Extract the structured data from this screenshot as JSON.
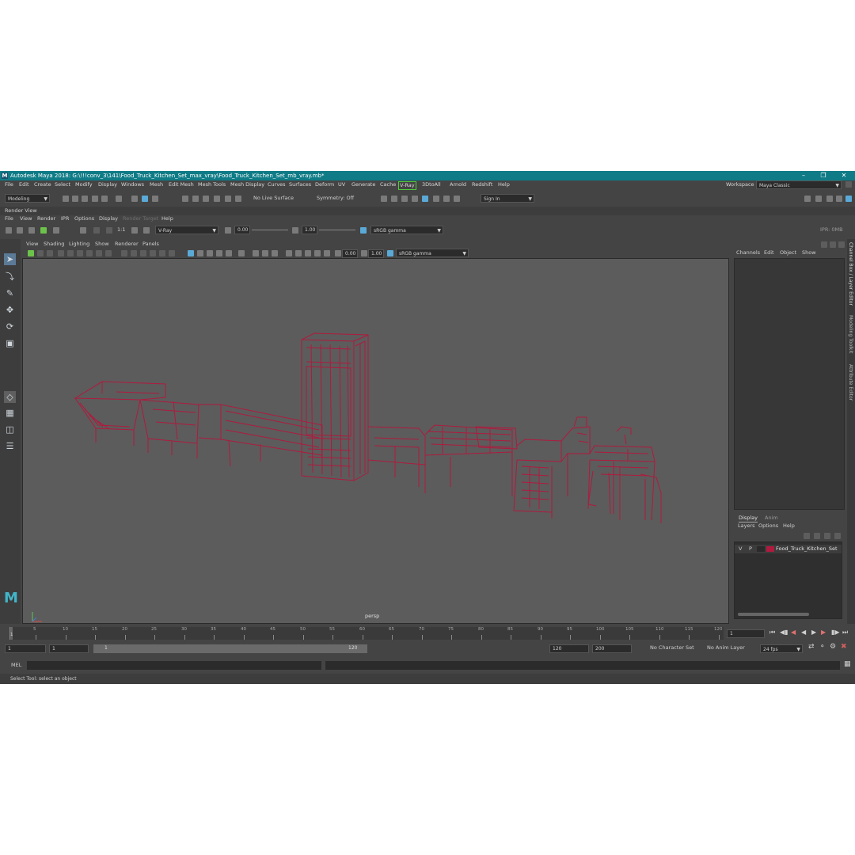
{
  "title": "Autodesk Maya 2018: G:\\!!!conv_3\\141\\Food_Truck_Kitchen_Set_max_vray\\Food_Truck_Kitchen_Set_mb_vray.mb*",
  "menubar": [
    "File",
    "Edit",
    "Create",
    "Select",
    "Modify",
    "Display",
    "Windows",
    "Mesh",
    "Edit Mesh",
    "Mesh Tools",
    "Mesh Display",
    "Curves",
    "Surfaces",
    "Deform",
    "UV",
    "Generate",
    "Cache",
    "V-Ray",
    "3DtoAll",
    "Arnold",
    "Redshift",
    "Help"
  ],
  "workspace_label": "Workspace :",
  "workspace_value": "Maya Classic",
  "shelf": {
    "mode": "Modeling",
    "live_surface": "No Live Surface",
    "symmetry": "Symmetry: Off",
    "sign_in": "Sign In"
  },
  "render_view": {
    "title": "Render View",
    "menu": [
      "File",
      "View",
      "Render",
      "IPR",
      "Options",
      "Display",
      "Render Target",
      "Help"
    ],
    "ratio": "1:1",
    "renderer": "V-Ray",
    "exposure": "0.00",
    "gamma": "1.00",
    "colorspace": "sRGB gamma",
    "ipr": "IPR: 0MB"
  },
  "panel": {
    "menu": [
      "View",
      "Shading",
      "Lighting",
      "Show",
      "Renderer",
      "Panels"
    ],
    "exposure": "0.00",
    "gamma": "1.00",
    "colorspace": "sRGB gamma",
    "camera": "persp"
  },
  "channel_box": {
    "menu": [
      "Channels",
      "Edit",
      "Object",
      "Show"
    ]
  },
  "layer_editor": {
    "tabs": [
      "Display",
      "Anim"
    ],
    "menu": [
      "Layers",
      "Options",
      "Help"
    ],
    "layer": {
      "v": "V",
      "p": "P",
      "name": "Food_Truck_Kitchen_Set",
      "color": "#b01a3e"
    }
  },
  "side_tabs": [
    "Channel Box / Layer Editor",
    "Modeling Toolkit",
    "Attribute Editor"
  ],
  "timeline": {
    "ticks": [
      "1",
      "5",
      "10",
      "15",
      "20",
      "25",
      "30",
      "35",
      "40",
      "45",
      "50",
      "55",
      "60",
      "65",
      "70",
      "75",
      "80",
      "85",
      "90",
      "95",
      "100",
      "105",
      "110",
      "115",
      "120"
    ],
    "current_frame": "1"
  },
  "range": {
    "start": "1",
    "playback_start": "1",
    "slider_start": "1",
    "slider_end": "120",
    "playback_end": "120",
    "end": "200",
    "character_set": "No Character Set",
    "anim_layer": "No Anim Layer",
    "fps": "24 fps"
  },
  "mel_label": "MEL",
  "status": "Select Tool: select an object",
  "colors": {
    "wire": "#b01a3e",
    "accent": "#5aa9d6",
    "titlebar": "#0e7b86"
  }
}
